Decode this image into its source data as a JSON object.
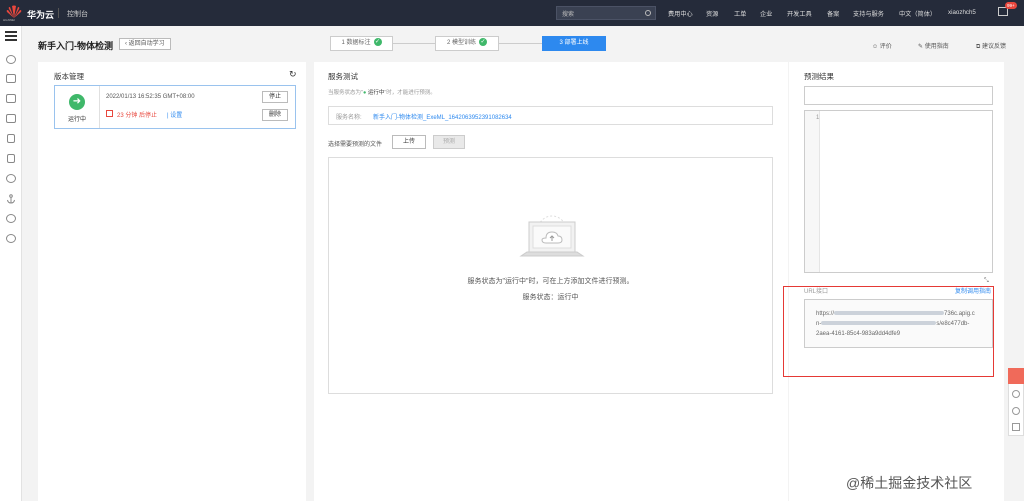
{
  "topbar": {
    "logo_text": "HUAWEI",
    "brand": "华为云",
    "console": "控制台",
    "search_placeholder": "搜索",
    "nav": [
      "费用中心",
      "资源",
      "工单",
      "企业",
      "开发工具",
      "备案",
      "支持与服务",
      "中文（简体）",
      "xiaozhch5"
    ],
    "badge": "99+"
  },
  "header": {
    "title": "新手入门-物体检测",
    "back_label": "返回自动学习",
    "steps": [
      "1 数据标注",
      "2 模型训练",
      "3 部署上线"
    ],
    "links": [
      "评价",
      "使用指南",
      "建议反馈"
    ]
  },
  "version": {
    "title": "版本管理",
    "status": "运行中",
    "date": "2022/01/13 16:52:35 GMT+08:00",
    "timer": "23 分钟 后停止",
    "set_label": "设置",
    "stop_label": "停止",
    "delete_label": "删除"
  },
  "service": {
    "title": "服务测试",
    "hint_prefix": "当服务状态为\"",
    "hint_status": "运行中",
    "hint_suffix": "\"时，才能进行预测。",
    "name_label": "服务名称:",
    "name_value": "新手入门-物体检测_ExeML_1642063952391082634",
    "file_label": "选择需要预测的文件",
    "upload_label": "上传",
    "predict_label": "预测",
    "empty_msg": "服务状态为\"运行中\"时，可在上方添加文件进行预测。",
    "state_label": "服务状态：",
    "state_value": "运行中"
  },
  "result": {
    "title": "预测结果",
    "line_no": "1",
    "url_label": "URL接口",
    "copy_label": "复制调用指南",
    "url_visible_1": "https://",
    "url_visible_2": "736c.apig.c",
    "url_visible_3": "n-",
    "url_visible_4": "s/e8c477db-",
    "url_visible_5": "2aea-4161-85c4-983a9dd4dfe9"
  },
  "watermark": "@稀土掘金技术社区"
}
